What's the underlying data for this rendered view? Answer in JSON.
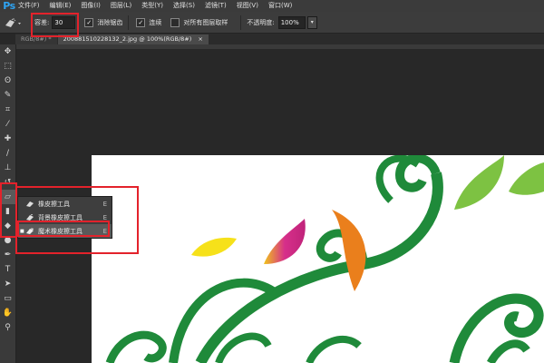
{
  "app": {
    "logo": "Ps"
  },
  "menu": [
    "文件(F)",
    "编辑(E)",
    "图像(I)",
    "图层(L)",
    "类型(Y)",
    "选择(S)",
    "滤镜(T)",
    "视图(V)",
    "窗口(W)"
  ],
  "options": {
    "tolerance_label": "容差:",
    "tolerance_value": "30",
    "antialias_label": "消除锯齿",
    "contiguous_label": "连续",
    "sample_all_label": "对所有图层取样",
    "opacity_label": "不透明度:",
    "opacity_value": "100%",
    "checked_mark": "✓"
  },
  "tabs": [
    {
      "label": "RGB/8#) *",
      "active": false
    },
    {
      "label": "20088151022813​2_2.jpg @ 100%(RGB/8#)",
      "active": true
    }
  ],
  "tab_close": "×",
  "flyout": {
    "items": [
      {
        "label": "橡皮擦工具",
        "key": "E",
        "selected": false
      },
      {
        "label": "背景橡皮擦工具",
        "key": "E",
        "selected": false
      },
      {
        "label": "魔术橡皮擦工具",
        "key": "E",
        "selected": true
      }
    ],
    "current_marker": "■"
  },
  "colors": {
    "highlight": "#e3222b",
    "green_dark": "#1f8a3a",
    "green_light": "#7dc242",
    "orange": "#ea7f1c",
    "magenta": "#d62f8a",
    "yellow": "#f6e11a"
  }
}
